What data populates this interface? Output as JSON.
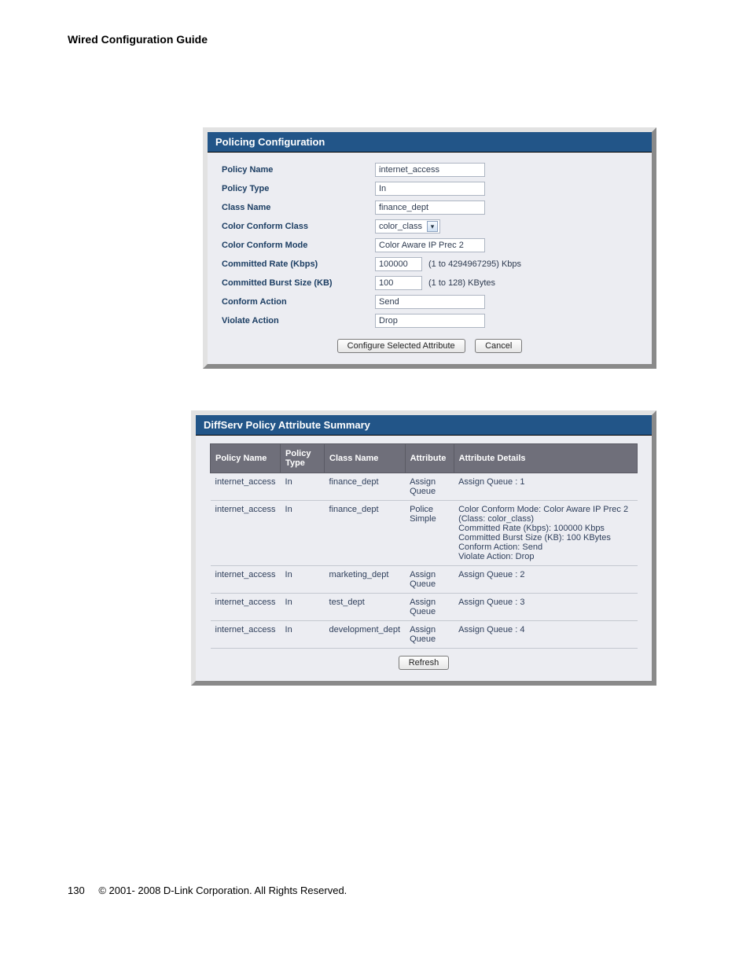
{
  "page": {
    "title": "Wired Configuration Guide",
    "number": "130",
    "copyright": "© 2001- 2008 D-Link Corporation. All Rights Reserved."
  },
  "panel1": {
    "title": "Policing Configuration",
    "rows": {
      "policy_name": {
        "label": "Policy Name",
        "value": "internet_access"
      },
      "policy_type": {
        "label": "Policy Type",
        "value": "In"
      },
      "class_name": {
        "label": "Class Name",
        "value": "finance_dept"
      },
      "color_conform_class": {
        "label": "Color Conform Class",
        "value": "color_class"
      },
      "color_conform_mode": {
        "label": "Color Conform Mode",
        "value": "Color Aware IP Prec 2"
      },
      "committed_rate": {
        "label": "Committed Rate (Kbps)",
        "value": "100000",
        "suffix": "(1 to 4294967295) Kbps"
      },
      "committed_burst": {
        "label": "Committed Burst Size (KB)",
        "value": "100",
        "suffix": "(1 to 128) KBytes"
      },
      "conform_action": {
        "label": "Conform Action",
        "value": "Send"
      },
      "violate_action": {
        "label": "Violate Action",
        "value": "Drop"
      }
    },
    "buttons": {
      "configure": "Configure Selected Attribute",
      "cancel": "Cancel"
    }
  },
  "panel2": {
    "title": "DiffServ Policy Attribute Summary",
    "headers": {
      "c1": "Policy Name",
      "c2": "Policy Type",
      "c3": "Class Name",
      "c4": "Attribute",
      "c5": "Attribute Details"
    },
    "rows": [
      {
        "c1": "internet_access",
        "c2": "In",
        "c3": "finance_dept",
        "c4": "Assign Queue",
        "c5": "Assign Queue :   1"
      },
      {
        "c1": "internet_access",
        "c2": "In",
        "c3": "finance_dept",
        "c4": "Police Simple",
        "c5": "Color Conform Mode:   Color Aware IP Prec 2  (Class:  color_class)\nCommitted Rate (Kbps):   100000 Kbps\nCommitted Burst Size (KB):   100 KBytes\nConform Action:   Send\nViolate Action:   Drop"
      },
      {
        "c1": "internet_access",
        "c2": "In",
        "c3": "marketing_dept",
        "c4": "Assign Queue",
        "c5": "Assign Queue :   2"
      },
      {
        "c1": "internet_access",
        "c2": "In",
        "c3": "test_dept",
        "c4": "Assign Queue",
        "c5": "Assign Queue :   3"
      },
      {
        "c1": "internet_access",
        "c2": "In",
        "c3": "development_dept",
        "c4": "Assign Queue",
        "c5": "Assign Queue :   4"
      }
    ],
    "buttons": {
      "refresh": "Refresh"
    }
  }
}
